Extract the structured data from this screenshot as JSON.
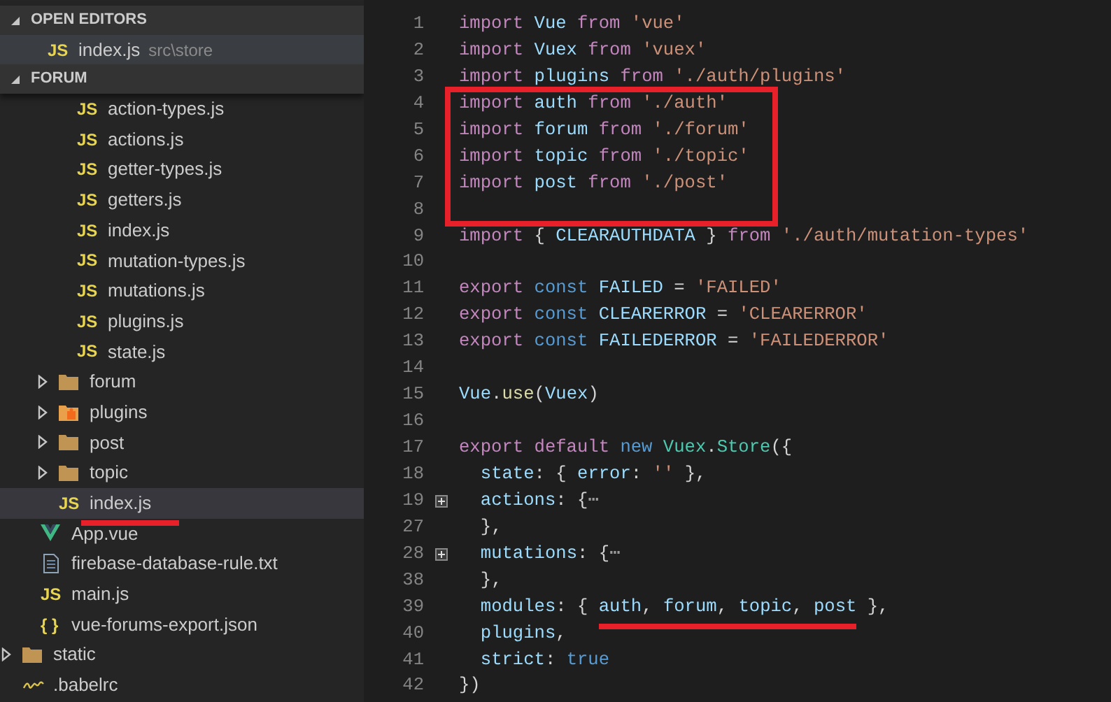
{
  "sidebar": {
    "sections": [
      {
        "title": "OPEN EDITORS",
        "expanded": true,
        "items": [
          {
            "badge": "JS",
            "name": "index.js",
            "path": "src\\store",
            "selected": true
          }
        ]
      },
      {
        "title": "FORUM",
        "expanded": true
      }
    ],
    "tree": [
      {
        "children": [
          {
            "children": [
              {
                "children": [
                  {
                    "badge": "JS",
                    "name": "action-types.js",
                    "selected": false
                  },
                  {
                    "badge": "JS",
                    "name": "actions.js",
                    "selected": false
                  },
                  {
                    "badge": "JS",
                    "name": "getter-types.js",
                    "selected": false
                  },
                  {
                    "badge": "JS",
                    "name": "getters.js",
                    "selected": false
                  },
                  {
                    "badge": "JS",
                    "name": "index.js",
                    "selected": false
                  },
                  {
                    "badge": "JS",
                    "name": "mutation-types.js",
                    "selected": false
                  },
                  {
                    "badge": "JS",
                    "name": "mutations.js",
                    "selected": false
                  },
                  {
                    "badge": "JS",
                    "name": "plugins.js",
                    "selected": false
                  },
                  {
                    "badge": "JS",
                    "name": "state.js",
                    "selected": false
                  }
                ]
              },
              {
                "kind": "folder",
                "name": "forum",
                "expanded": false,
                "selected": false
              },
              {
                "kind": "plugin",
                "name": "plugins",
                "expanded": false,
                "selected": false
              },
              {
                "kind": "folder",
                "name": "post",
                "expanded": false,
                "selected": false
              },
              {
                "kind": "folder",
                "name": "topic",
                "expanded": false,
                "selected": false
              },
              {
                "badge": "JS",
                "name": "index.js",
                "selected": true,
                "underlined": true
              }
            ]
          },
          {
            "kind": "vue",
            "name": "App.vue",
            "selected": false
          },
          {
            "kind": "text",
            "name": "firebase-database-rule.txt",
            "selected": false
          },
          {
            "badge": "JS",
            "name": "main.js",
            "selected": false
          },
          {
            "badge": "{ }",
            "name": "vue-forums-export.json",
            "selected": false
          }
        ]
      },
      {
        "kind": "folder",
        "name": "static",
        "expanded": false,
        "selected": false
      },
      {
        "kind": "config",
        "name": ".babelrc",
        "selected": false
      }
    ]
  },
  "editor": {
    "lines": [
      {
        "number": "1",
        "tokens": [
          {
            "text": "import ",
            "kind": "keyword"
          },
          {
            "text": "Vue",
            "kind": "ident"
          },
          {
            "text": " from ",
            "kind": "keyword"
          },
          {
            "text": "'vue'",
            "kind": "string"
          }
        ]
      },
      {
        "number": "2",
        "tokens": [
          {
            "text": "import ",
            "kind": "keyword"
          },
          {
            "text": "Vuex",
            "kind": "ident"
          },
          {
            "text": " from ",
            "kind": "keyword"
          },
          {
            "text": "'vuex'",
            "kind": "string"
          }
        ]
      },
      {
        "number": "3",
        "tokens": [
          {
            "text": "import ",
            "kind": "keyword"
          },
          {
            "text": "plugins",
            "kind": "ident"
          },
          {
            "text": " from ",
            "kind": "keyword"
          },
          {
            "text": "'./auth/plugins'",
            "kind": "string"
          }
        ]
      },
      {
        "number": "4",
        "boxed": true,
        "tokens": [
          {
            "text": "import ",
            "kind": "keyword"
          },
          {
            "text": "auth",
            "kind": "ident"
          },
          {
            "text": " from ",
            "kind": "keyword"
          },
          {
            "text": "'./auth'",
            "kind": "string"
          }
        ]
      },
      {
        "number": "5",
        "boxed": true,
        "tokens": [
          {
            "text": "import ",
            "kind": "keyword"
          },
          {
            "text": "forum",
            "kind": "ident"
          },
          {
            "text": " from ",
            "kind": "keyword"
          },
          {
            "text": "'./forum'",
            "kind": "string"
          }
        ]
      },
      {
        "number": "6",
        "boxed": true,
        "tokens": [
          {
            "text": "import ",
            "kind": "keyword"
          },
          {
            "text": "topic",
            "kind": "ident"
          },
          {
            "text": " from ",
            "kind": "keyword"
          },
          {
            "text": "'./topic'",
            "kind": "string"
          }
        ]
      },
      {
        "number": "7",
        "boxed": true,
        "tokens": [
          {
            "text": "import ",
            "kind": "keyword"
          },
          {
            "text": "post",
            "kind": "ident"
          },
          {
            "text": " from ",
            "kind": "keyword"
          },
          {
            "text": "'./post'",
            "kind": "string"
          }
        ]
      },
      {
        "number": "8",
        "boxed": true
      },
      {
        "number": "9",
        "tokens": [
          {
            "text": "import ",
            "kind": "keyword"
          },
          {
            "text": "{ ",
            "kind": "plain"
          },
          {
            "text": "CLEARAUTHDATA",
            "kind": "ident"
          },
          {
            "text": " } ",
            "kind": "plain"
          },
          {
            "text": "from ",
            "kind": "keyword"
          },
          {
            "text": "'./auth/mutation-types'",
            "kind": "string"
          }
        ]
      },
      {
        "number": "10"
      },
      {
        "number": "11",
        "tokens": [
          {
            "text": "export ",
            "kind": "keyword"
          },
          {
            "text": "const ",
            "kind": "storage"
          },
          {
            "text": "FAILED",
            "kind": "ident"
          },
          {
            "text": " = ",
            "kind": "plain"
          },
          {
            "text": "'FAILED'",
            "kind": "string"
          }
        ]
      },
      {
        "number": "12",
        "tokens": [
          {
            "text": "export ",
            "kind": "keyword"
          },
          {
            "text": "const ",
            "kind": "storage"
          },
          {
            "text": "CLEARERROR",
            "kind": "ident"
          },
          {
            "text": " = ",
            "kind": "plain"
          },
          {
            "text": "'CLEARERROR'",
            "kind": "string"
          }
        ]
      },
      {
        "number": "13",
        "tokens": [
          {
            "text": "export ",
            "kind": "keyword"
          },
          {
            "text": "const ",
            "kind": "storage"
          },
          {
            "text": "FAILEDERROR",
            "kind": "ident"
          },
          {
            "text": " = ",
            "kind": "plain"
          },
          {
            "text": "'FAILEDERROR'",
            "kind": "string"
          }
        ]
      },
      {
        "number": "14"
      },
      {
        "number": "15",
        "tokens": [
          {
            "text": "Vue",
            "kind": "ident"
          },
          {
            "text": ".",
            "kind": "plain"
          },
          {
            "text": "use",
            "kind": "function"
          },
          {
            "text": "(",
            "kind": "plain"
          },
          {
            "text": "Vuex",
            "kind": "ident"
          },
          {
            "text": ")",
            "kind": "plain"
          }
        ]
      },
      {
        "number": "16"
      },
      {
        "number": "17",
        "tokens": [
          {
            "text": "export ",
            "kind": "keyword"
          },
          {
            "text": "default ",
            "kind": "keyword"
          },
          {
            "text": "new ",
            "kind": "storage"
          },
          {
            "text": "Vuex",
            "kind": "class"
          },
          {
            "text": ".",
            "kind": "plain"
          },
          {
            "text": "Store",
            "kind": "class"
          },
          {
            "text": "({",
            "kind": "plain"
          }
        ]
      },
      {
        "number": "18",
        "indented": true,
        "tokens": [
          {
            "text": "state",
            "kind": "ident"
          },
          {
            "text": ": { ",
            "kind": "plain"
          },
          {
            "text": "error",
            "kind": "ident"
          },
          {
            "text": ": ",
            "kind": "plain"
          },
          {
            "text": "''",
            "kind": "string"
          },
          {
            "text": " },",
            "kind": "plain"
          }
        ]
      },
      {
        "number": "19",
        "indented": true,
        "folded": true,
        "tokens": [
          {
            "text": "actions",
            "kind": "ident"
          },
          {
            "text": ": {",
            "kind": "plain"
          },
          {
            "text": "⋯",
            "kind": "fold"
          }
        ]
      },
      {
        "number": "27",
        "indented": true,
        "tokens": [
          {
            "text": "},",
            "kind": "plain"
          }
        ]
      },
      {
        "number": "28",
        "indented": true,
        "folded": true,
        "tokens": [
          {
            "text": "mutations",
            "kind": "ident"
          },
          {
            "text": ": {",
            "kind": "plain"
          },
          {
            "text": "⋯",
            "kind": "fold"
          }
        ]
      },
      {
        "number": "38",
        "indented": true,
        "tokens": [
          {
            "text": "},",
            "kind": "plain"
          }
        ]
      },
      {
        "number": "39",
        "indented": true,
        "tokens": [
          {
            "text": "modules",
            "kind": "ident"
          },
          {
            "text": ": { ",
            "kind": "plain"
          },
          {
            "text": "auth",
            "kind": "ident",
            "underlined": true
          },
          {
            "text": ", ",
            "kind": "plain",
            "underlined": true
          },
          {
            "text": "forum",
            "kind": "ident",
            "underlined": true
          },
          {
            "text": ", ",
            "kind": "plain",
            "underlined": true
          },
          {
            "text": "topic",
            "kind": "ident",
            "underlined": true
          },
          {
            "text": ", ",
            "kind": "plain",
            "underlined": true
          },
          {
            "text": "post",
            "kind": "ident",
            "underlined": true
          },
          {
            "text": " },",
            "kind": "plain"
          }
        ]
      },
      {
        "number": "40",
        "indented": true,
        "tokens": [
          {
            "text": "plugins",
            "kind": "ident"
          },
          {
            "text": ",",
            "kind": "plain"
          }
        ]
      },
      {
        "number": "41",
        "indented": true,
        "tokens": [
          {
            "text": "strict",
            "kind": "ident"
          },
          {
            "text": ": ",
            "kind": "plain"
          },
          {
            "text": "true",
            "kind": "storage"
          }
        ]
      },
      {
        "number": "42",
        "tokens": [
          {
            "text": "})",
            "kind": "plain"
          }
        ]
      }
    ]
  }
}
